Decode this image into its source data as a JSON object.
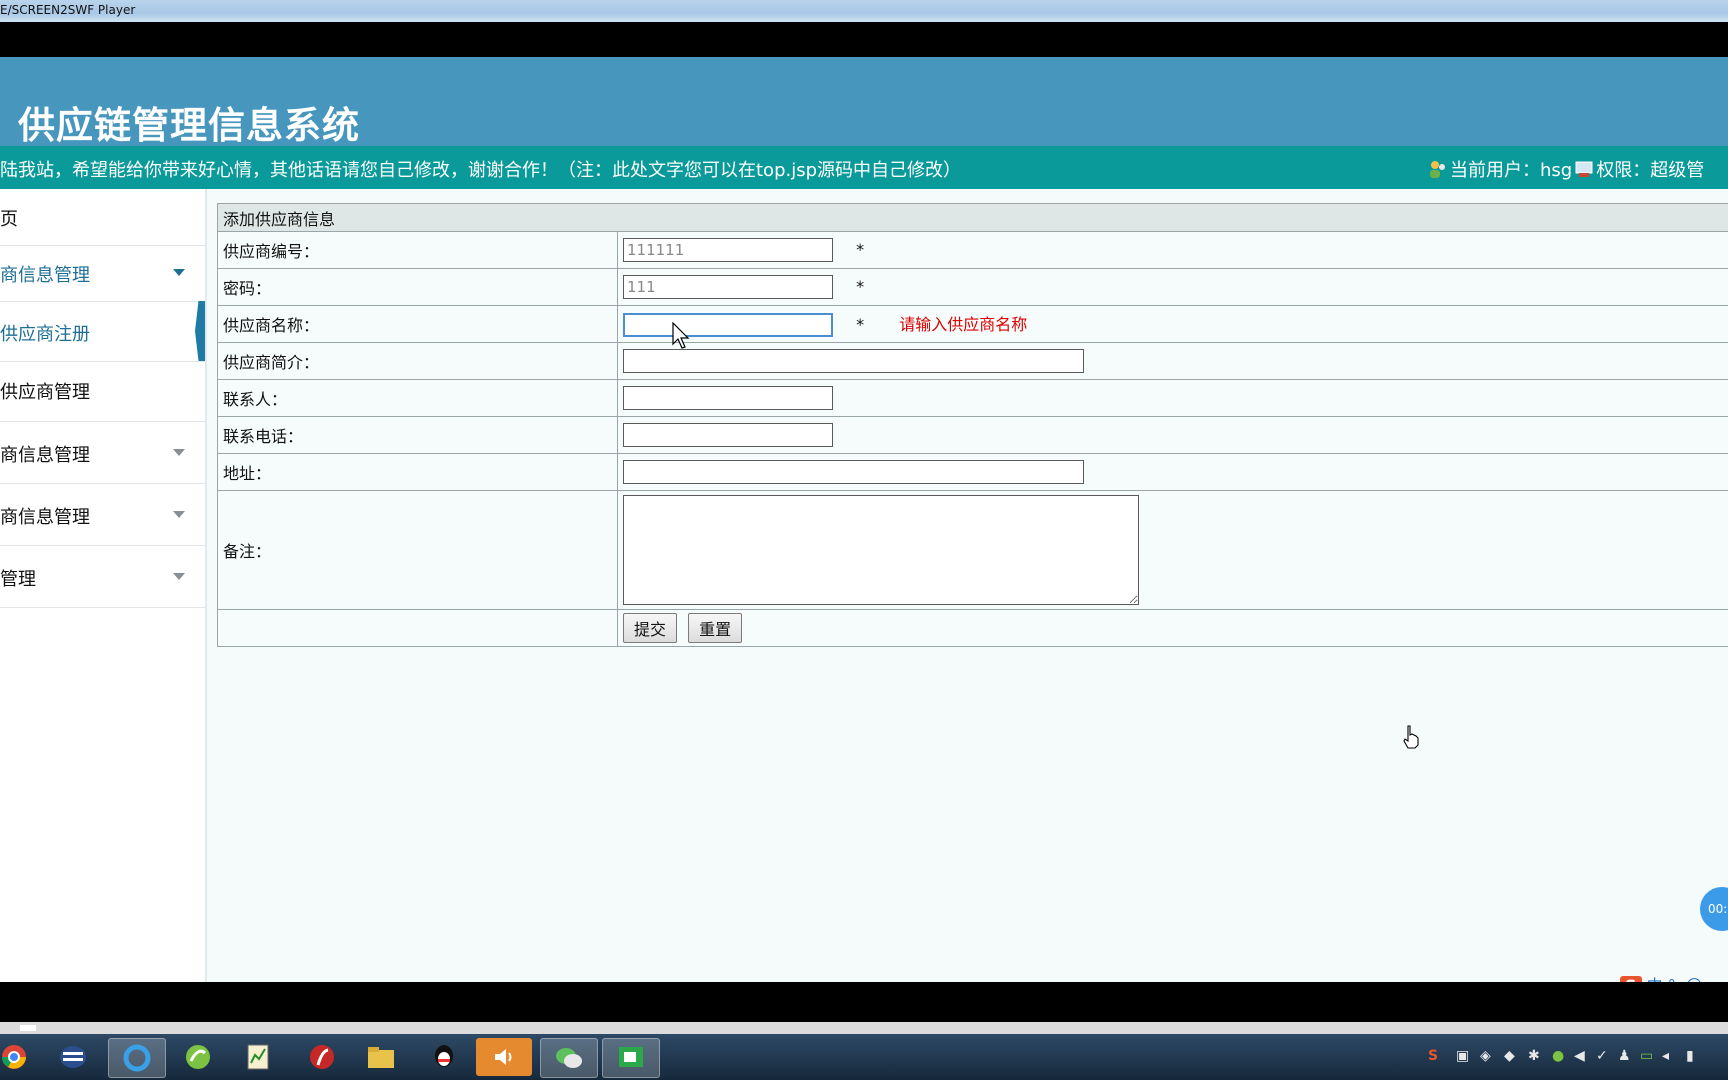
{
  "player": {
    "title": "E/SCREEN2SWF Player"
  },
  "header": {
    "title": "供应链管理信息系统"
  },
  "notice": {
    "text": "陆我站，希望能给你带来好心情，其他话语请您自己修改，谢谢合作！（注：此处文字您可以在top.jsp源码中自己修改）"
  },
  "user": {
    "current_user": "当前用户：hsg",
    "permission": "权限：超级管"
  },
  "sidebar": {
    "items": [
      {
        "label": "页"
      },
      {
        "label": "商信息管理"
      },
      {
        "label": "供应商注册"
      },
      {
        "label": "供应商管理"
      },
      {
        "label": "商信息管理"
      },
      {
        "label": "商信息管理"
      },
      {
        "label": "管理"
      }
    ]
  },
  "form": {
    "title": "添加供应商信息",
    "fields": [
      {
        "label": "供应商编号：",
        "value": "111111",
        "required": "*"
      },
      {
        "label": "密码：",
        "value": "111",
        "required": "*"
      },
      {
        "label": "供应商名称：",
        "value": "",
        "required": "*",
        "error": "请输入供应商名称"
      },
      {
        "label": "供应商简介：",
        "value": ""
      },
      {
        "label": "联系人：",
        "value": ""
      },
      {
        "label": "联系电话：",
        "value": ""
      },
      {
        "label": "地址：",
        "value": ""
      },
      {
        "label": "备注：",
        "value": ""
      }
    ],
    "submit_label": "提交",
    "reset_label": "重置"
  },
  "ime": {
    "logo": "S",
    "mode": "中",
    "punct": "°,",
    "emoji": "☺"
  },
  "timer": {
    "text": "00:"
  },
  "colors": {
    "header": "#4796bd",
    "notice": "#0a9a9a",
    "accent": "#1d6f96",
    "error": "#dd0000"
  }
}
